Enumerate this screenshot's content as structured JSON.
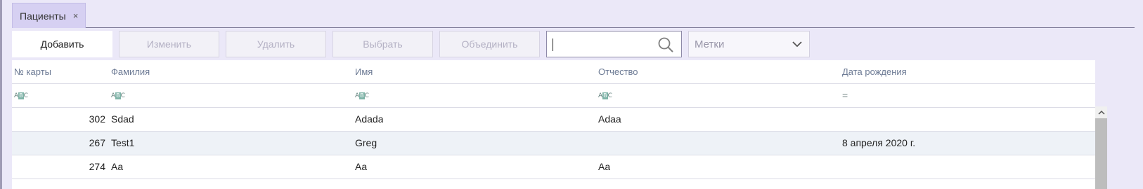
{
  "tab": {
    "label": "Пациенты",
    "close": "×"
  },
  "toolbar": {
    "add": "Добавить",
    "edit": "Изменить",
    "delete": "Удалить",
    "select": "Выбрать",
    "merge": "Объединить",
    "search_value": "",
    "tags_placeholder": "Метки"
  },
  "table": {
    "columns": [
      "№ карты",
      "Фамилия",
      "Имя",
      "Отчество",
      "Дата рождения"
    ],
    "rows": [
      [
        "302",
        "Sdad",
        "Adada",
        "Adaa",
        ""
      ],
      [
        "267",
        "Test1",
        "Greg",
        "",
        "8 апреля 2020 г."
      ],
      [
        "274",
        "Aa",
        "Aa",
        "Aa",
        ""
      ]
    ]
  },
  "icons": {
    "text_filter": "abc-filter-icon",
    "date_filter": "equals-filter-icon",
    "search": "search-icon",
    "dropdown": "chevron-down-icon",
    "scroll_up": "chevron-up-icon"
  },
  "colors": {
    "background": "#ebe8f8",
    "tab_active": "#d6d0f2",
    "header_text": "#6c7a94",
    "row_alt": "#eef2f7"
  }
}
